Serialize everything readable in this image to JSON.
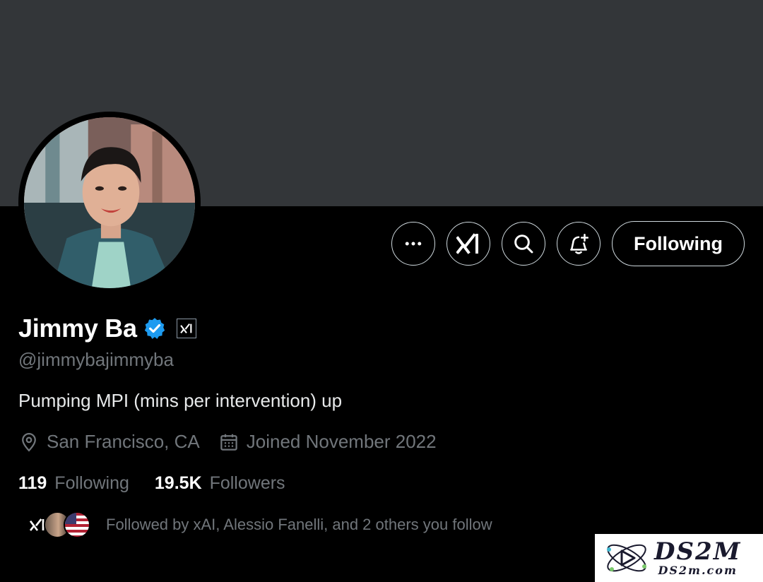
{
  "profile": {
    "display_name": "Jimmy Ba",
    "handle": "@jimmybajimmyba",
    "bio": "Pumping MPI (mins per intervention) up",
    "location": "San Francisco, CA",
    "joined": "Joined November 2022",
    "verified": true,
    "affiliation_badge_icon": "xai-logo-icon"
  },
  "actions": {
    "more_icon": "more-dots-icon",
    "grok_icon": "xai-logo-icon",
    "search_icon": "search-icon",
    "notify_icon": "bell-plus-icon",
    "follow_label": "Following"
  },
  "stats": {
    "following_count": "119",
    "following_label": "Following",
    "followers_count": "19.5K",
    "followers_label": "Followers"
  },
  "followed_by": {
    "text": "Followed by xAI, Alessio Fanelli, and 2 others you follow"
  },
  "watermark": {
    "main": "DS2M",
    "sub": "DS2m.com"
  },
  "colors": {
    "background": "#000000",
    "banner": "#333639",
    "primary_text": "#e7e9ea",
    "secondary_text": "#71767b",
    "verified_blue": "#1d9bf0",
    "button_border": "#cfd9de"
  }
}
